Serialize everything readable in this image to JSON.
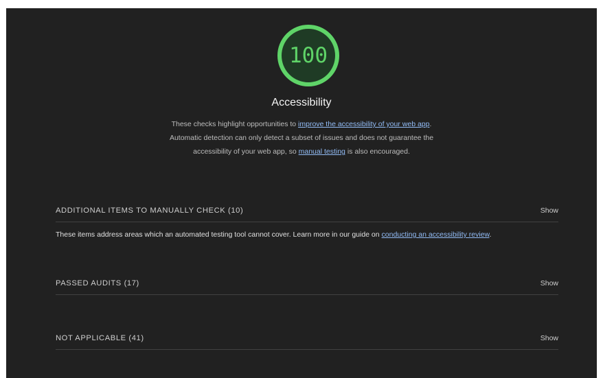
{
  "category": {
    "score": "100",
    "title": "Accessibility",
    "desc_intro": "These checks highlight opportunities to ",
    "desc_link1": "improve the accessibility of your web app",
    "desc_mid": ". Automatic detection can only detect a subset of issues and does not guarantee the accessibility of your web app, so ",
    "desc_link2": "manual testing",
    "desc_end": " is also encouraged.",
    "gauge_color": "#5fd468"
  },
  "groups": [
    {
      "title": "ADDITIONAL ITEMS TO MANUALLY CHECK (10)",
      "toggle": "Show",
      "desc_intro": "These items address areas which an automated testing tool cannot cover. Learn more in our guide on ",
      "desc_link": "conducting an accessibility review",
      "desc_end": "."
    },
    {
      "title": "PASSED AUDITS (17)",
      "toggle": "Show"
    },
    {
      "title": "NOT APPLICABLE (41)",
      "toggle": "Show"
    }
  ],
  "colors": {
    "background": "#212121",
    "link": "#93bdf7",
    "pass": "#5fd468"
  }
}
